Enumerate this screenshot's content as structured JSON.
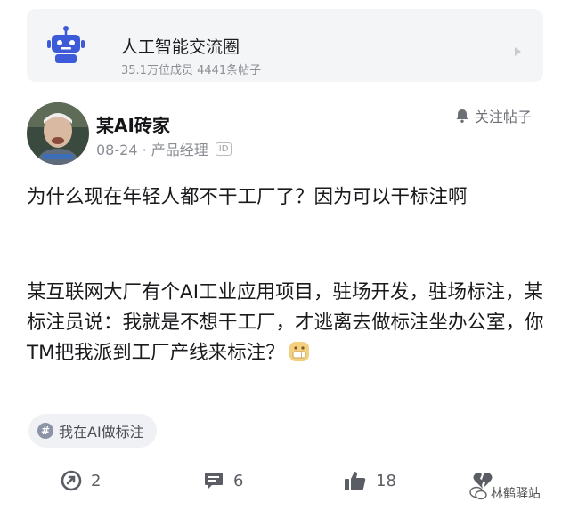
{
  "community": {
    "name": "人工智能交流圈",
    "stats": "35.1万位成员 4441条帖子",
    "icon": "robot-icon"
  },
  "author": {
    "name": "某AI砖家",
    "meta": "08-24 · 产品经理",
    "id_badge": "ID",
    "follow_label": "关注帖子"
  },
  "post": {
    "paragraph1": "为什么现在年轻人都不干工厂了？因为可以干标注啊",
    "paragraph2": "某互联网大厂有个AI工业应用项目，驻场开发，驻场标注，某标注员说：我就是不想干工厂，才逃离去做标注坐办公室，你TM把我派到工厂产线来标注？",
    "emoji": "grimace-emoji"
  },
  "topic": {
    "label": "我在AI做标注",
    "hash": "#"
  },
  "actions": {
    "share_count": "2",
    "comment_count": "6",
    "like_count": "18"
  },
  "watermark": {
    "text": "林鹤驿站"
  },
  "colors": {
    "card_bg": "#f4f5f7",
    "robot_blue": "#3d5bd8",
    "text_secondary": "#8a8d93"
  }
}
